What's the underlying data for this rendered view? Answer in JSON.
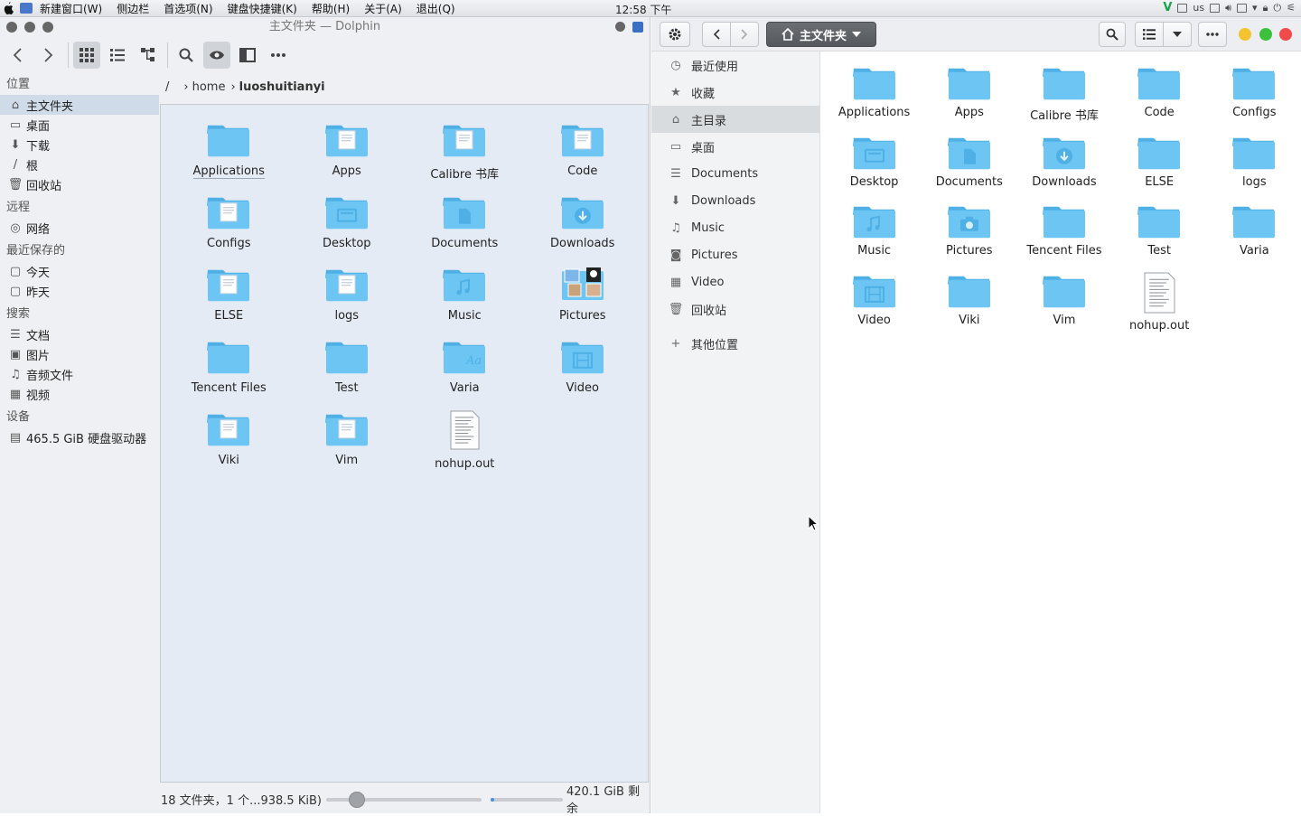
{
  "menubar": {
    "items": [
      "新建窗口(W)",
      "侧边栏",
      "首选项(N)",
      "键盘快捷键(K)",
      "帮助(H)",
      "关于(A)",
      "退出(Q)"
    ],
    "clock": "12:58 下午",
    "keyboard_layout": "us"
  },
  "dolphin": {
    "title": "主文件夹 — Dolphin",
    "places": {
      "sections": [
        {
          "heading": "位置",
          "items": [
            {
              "label": "主文件夹",
              "icon": "home-icon",
              "selected": true
            },
            {
              "label": "桌面",
              "icon": "desktop-icon"
            },
            {
              "label": "下载",
              "icon": "download-icon"
            },
            {
              "label": "根",
              "icon": "root-icon"
            },
            {
              "label": "回收站",
              "icon": "trash-icon"
            }
          ]
        },
        {
          "heading": "远程",
          "items": [
            {
              "label": "网络",
              "icon": "network-icon"
            }
          ]
        },
        {
          "heading": "最近保存的",
          "items": [
            {
              "label": "今天",
              "icon": "calendar-icon"
            },
            {
              "label": "昨天",
              "icon": "calendar-icon"
            }
          ]
        },
        {
          "heading": "搜索",
          "items": [
            {
              "label": "文档",
              "icon": "document-icon"
            },
            {
              "label": "图片",
              "icon": "image-icon"
            },
            {
              "label": "音频文件",
              "icon": "audio-icon"
            },
            {
              "label": "视频",
              "icon": "video-icon"
            }
          ]
        },
        {
          "heading": "设备",
          "items": [
            {
              "label": "465.5 GiB 硬盘驱动器",
              "icon": "harddisk-icon"
            }
          ]
        }
      ]
    },
    "breadcrumb": {
      "root": "/",
      "parts": [
        "home",
        "luoshuitianyi"
      ]
    },
    "items": [
      {
        "label": "Applications",
        "kind": "folder",
        "underline": true
      },
      {
        "label": "Apps",
        "kind": "folder-doc"
      },
      {
        "label": "Calibre 书库",
        "kind": "folder-doc"
      },
      {
        "label": "Code",
        "kind": "folder-doc"
      },
      {
        "label": "Configs",
        "kind": "folder-doc"
      },
      {
        "label": "Desktop",
        "kind": "folder-desktop"
      },
      {
        "label": "Documents",
        "kind": "folder-documents"
      },
      {
        "label": "Downloads",
        "kind": "folder-downloads"
      },
      {
        "label": "ELSE",
        "kind": "folder-doc"
      },
      {
        "label": "logs",
        "kind": "folder-doc"
      },
      {
        "label": "Music",
        "kind": "folder-music"
      },
      {
        "label": "Pictures",
        "kind": "folder-pictures"
      },
      {
        "label": "Tencent Files",
        "kind": "folder"
      },
      {
        "label": "Test",
        "kind": "folder"
      },
      {
        "label": "Varia",
        "kind": "folder-font"
      },
      {
        "label": "Video",
        "kind": "folder-video"
      },
      {
        "label": "Viki",
        "kind": "folder-doc"
      },
      {
        "label": "Vim",
        "kind": "folder-doc"
      },
      {
        "label": "nohup.out",
        "kind": "file"
      }
    ],
    "status": {
      "summary": "18 文件夹，1 个...938.5 KiB)",
      "free": "420.1 GiB 剩余",
      "zoom_fraction": 0.2,
      "used_fraction": 0.05
    }
  },
  "nautilus": {
    "path_label": "主文件夹",
    "sidebar": [
      {
        "label": "最近使用",
        "icon": "clock-icon"
      },
      {
        "label": "收藏",
        "icon": "star-icon"
      },
      {
        "label": "主目录",
        "icon": "home-icon",
        "selected": true
      },
      {
        "label": "桌面",
        "icon": "desktop-icon"
      },
      {
        "label": "Documents",
        "icon": "document-icon"
      },
      {
        "label": "Downloads",
        "icon": "download-icon"
      },
      {
        "label": "Music",
        "icon": "music-icon"
      },
      {
        "label": "Pictures",
        "icon": "camera-icon"
      },
      {
        "label": "Video",
        "icon": "video-icon"
      },
      {
        "label": "回收站",
        "icon": "trash-icon"
      },
      {
        "label": "其他位置",
        "icon": "plus-icon"
      }
    ],
    "items": [
      {
        "label": "Applications",
        "kind": "folder"
      },
      {
        "label": "Apps",
        "kind": "folder"
      },
      {
        "label": "Calibre 书库",
        "kind": "folder"
      },
      {
        "label": "Code",
        "kind": "folder"
      },
      {
        "label": "Configs",
        "kind": "folder"
      },
      {
        "label": "Desktop",
        "kind": "folder-desktop"
      },
      {
        "label": "Documents",
        "kind": "folder-documents"
      },
      {
        "label": "Downloads",
        "kind": "folder-downloads"
      },
      {
        "label": "ELSE",
        "kind": "folder"
      },
      {
        "label": "logs",
        "kind": "folder"
      },
      {
        "label": "Music",
        "kind": "folder-music"
      },
      {
        "label": "Pictures",
        "kind": "folder-pictures"
      },
      {
        "label": "Tencent Files",
        "kind": "folder"
      },
      {
        "label": "Test",
        "kind": "folder"
      },
      {
        "label": "Varia",
        "kind": "folder"
      },
      {
        "label": "Video",
        "kind": "folder-video"
      },
      {
        "label": "Viki",
        "kind": "folder"
      },
      {
        "label": "Vim",
        "kind": "folder"
      },
      {
        "label": "nohup.out",
        "kind": "file"
      }
    ],
    "colors": {
      "close": "#f04a4a",
      "minimize": "#f4c430",
      "maximize": "#3cc13c"
    }
  },
  "colors": {
    "folder": "#6cc5f2",
    "folder_dark": "#4fb0e6",
    "dolphin_selection": "#cfdbe8"
  }
}
